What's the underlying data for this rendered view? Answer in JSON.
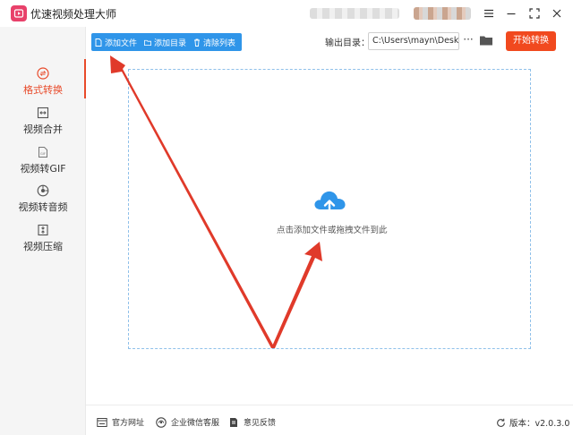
{
  "app": {
    "title": "优速视频处理大师",
    "logo_icon": "video-logo-icon"
  },
  "window_controls": [
    "menu-icon",
    "minimize-icon",
    "maximize-icon",
    "close-icon"
  ],
  "sidebar": {
    "items": [
      {
        "label": "格式转换",
        "icon": "format-convert-icon",
        "active": true
      },
      {
        "label": "视频合并",
        "icon": "video-merge-icon",
        "active": false
      },
      {
        "label": "视频转GIF",
        "icon": "gif-icon",
        "active": false
      },
      {
        "label": "视频转音频",
        "icon": "audio-icon",
        "active": false
      },
      {
        "label": "视频压缩",
        "icon": "compress-icon",
        "active": false
      }
    ]
  },
  "toolbar": {
    "add_file": "添加文件",
    "add_folder": "添加目录",
    "clear_list": "清除列表"
  },
  "output": {
    "label": "输出目录：",
    "path": "C:\\Users\\mayn\\Desktop",
    "more": "···"
  },
  "start_button": "开始转换",
  "dropzone": {
    "hint": "点击添加文件或拖拽文件到此",
    "icon": "cloud-upload-icon"
  },
  "footer": {
    "website": "官方网址",
    "wechat_support": "企业微信客服",
    "feedback": "意见反馈",
    "version": "版本：v2.0.3.0"
  },
  "colors": {
    "accent": "#2f95e9",
    "active_nav": "#e84a2a",
    "start_button": "#f1491e",
    "annotation_arrow": "#e03a2a"
  }
}
